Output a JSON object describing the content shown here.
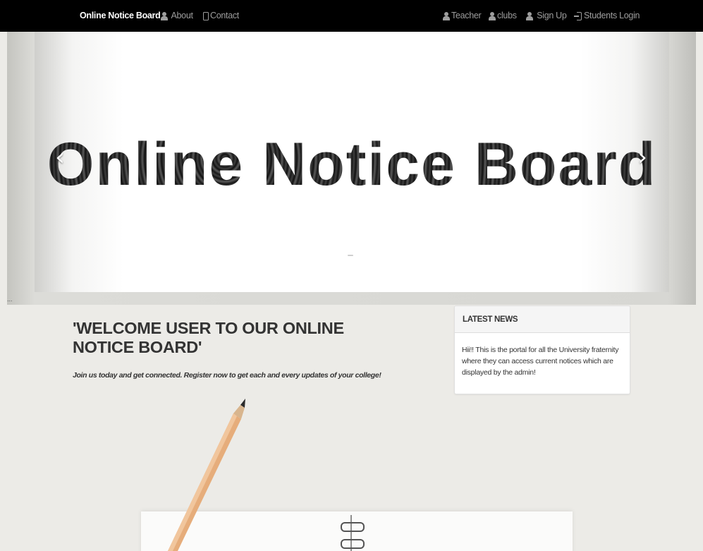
{
  "navbar": {
    "brand": "Online Notice Board",
    "left_links": [
      {
        "label": "About",
        "icon": "user-icon"
      },
      {
        "label": "Contact",
        "icon": "phone-icon"
      }
    ],
    "right_links": [
      {
        "label": "Teacher",
        "icon": "user-icon"
      },
      {
        "label": "clubs",
        "icon": "user-icon"
      },
      {
        "label": "Sign Up",
        "icon": "user-icon"
      },
      {
        "label": "Students Login",
        "icon": "log-in-icon"
      }
    ]
  },
  "carousel": {
    "slide_title": "Online Notice Board",
    "prev_icon": "chevron-left-icon",
    "next_icon": "chevron-right-icon",
    "caption_mark": "..."
  },
  "welcome": {
    "title": "'WELCOME USER TO OUR ONLINE NOTICE BOARD'",
    "subtitle": "Join us today and get connected. Register now to get each and every updates of your college!"
  },
  "news": {
    "heading": "LATEST NEWS",
    "body": "Hii!! This is the portal for all the University fraternity where they can access current notices which are displayed by the admin!"
  },
  "colors": {
    "navbar_bg": "#000000",
    "nav_text": "#9d9d9d",
    "brand_text": "#ffffff",
    "page_bg": "#ecebe7",
    "heading_text": "#333333"
  }
}
